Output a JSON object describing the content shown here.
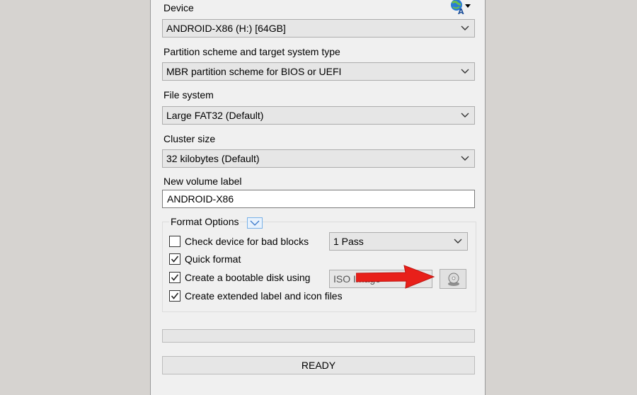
{
  "device": {
    "label": "Device",
    "value": "ANDROID-X86 (H:) [64GB]"
  },
  "partition": {
    "label": "Partition scheme and target system type",
    "value": "MBR partition scheme for BIOS or UEFI"
  },
  "file_system": {
    "label": "File system",
    "value": "Large FAT32 (Default)"
  },
  "cluster_size": {
    "label": "Cluster size",
    "value": "32 kilobytes (Default)"
  },
  "volume_label": {
    "label": "New volume label",
    "value": "ANDROID-X86"
  },
  "format_options": {
    "title": "Format Options",
    "bad_blocks": {
      "label": "Check device for bad blocks",
      "checked": false,
      "passes": "1 Pass"
    },
    "quick_format": {
      "label": "Quick format",
      "checked": true
    },
    "bootable": {
      "label": "Create a bootable disk using",
      "checked": true,
      "value": "ISO Image"
    },
    "extended_label": {
      "label": "Create extended label and icon files",
      "checked": true
    }
  },
  "progress": 0,
  "status": "READY",
  "icons": {
    "language": "globe-language-icon",
    "disc": "disc-drive-icon",
    "annotation": "red-arrow-annotation"
  },
  "colors": {
    "arrow": "#e8201a",
    "accent": "#7ab2e8"
  }
}
